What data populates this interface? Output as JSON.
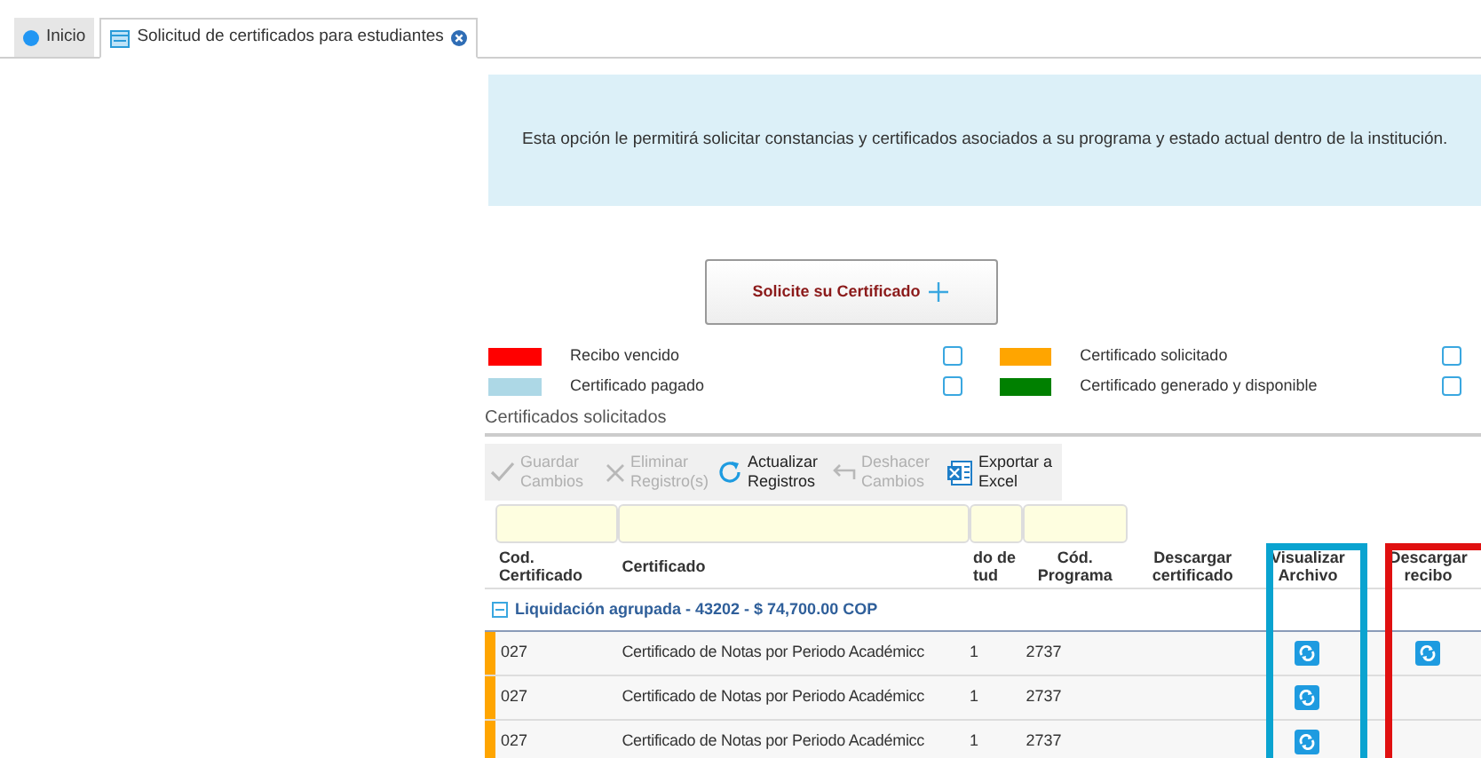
{
  "tabs": [
    {
      "label": "Inicio",
      "selected": false,
      "closable": false
    },
    {
      "label": "Solicitud de certificados para estudiantes",
      "selected": true,
      "closable": true
    }
  ],
  "info": "Esta opción le permitirá solicitar constancias y certificados asociados a su programa y estado actual dentro de la institución.",
  "request_button": {
    "label": "Solicite su Certificado"
  },
  "legend": [
    {
      "label": "Recibo vencido",
      "color": "#ff0000",
      "checked": false
    },
    {
      "label": "Certificado solicitado",
      "color": "#ffa500",
      "checked": false
    },
    {
      "label": "Certificado pagado",
      "color": "#add8e6",
      "checked": false
    },
    {
      "label": "Certificado generado y disponible",
      "color": "#008000",
      "checked": false
    }
  ],
  "section_title": "Certificados solicitados",
  "toolbar": [
    {
      "label": "Guardar Cambios",
      "kind": "check",
      "disabled": true
    },
    {
      "label": "Eliminar Registro(s)",
      "kind": "delete",
      "disabled": true
    },
    {
      "label": "Actualizar Registros",
      "kind": "refresh",
      "disabled": false
    },
    {
      "label": "Deshacer Cambios",
      "kind": "undo",
      "disabled": true
    },
    {
      "label": "Exportar a Excel",
      "kind": "excel",
      "disabled": false
    }
  ],
  "columns": [
    {
      "label": "Cod. Certificado",
      "filter": true
    },
    {
      "label": "Certificado",
      "filter": true
    },
    {
      "label": "do de tud",
      "filter": true
    },
    {
      "label": "Cód. Programa",
      "filter": true
    },
    {
      "label": "Descargar certificado",
      "filter": false
    },
    {
      "label": "Visualizar Archivo",
      "filter": false,
      "color": "#0aa3d0"
    },
    {
      "label": "Descargar recibo",
      "filter": false,
      "color": "#e01010"
    }
  ],
  "group": {
    "label": "Liquidación agrupada - 43202 - $ 74,700.00 COP",
    "expanded": true
  },
  "rows": [
    {
      "color": "#ffa500",
      "code": "027",
      "certificate": "Certificado de Notas por Periodo Académicc",
      "column_3": "1",
      "program": "2737",
      "view_file": true,
      "receipt": true
    },
    {
      "color": "#ffa500",
      "code": "027",
      "certificate": "Certificado de Notas por Periodo Académicc",
      "column_3": "1",
      "program": "2737",
      "view_file": true,
      "receipt": false
    },
    {
      "color": "#ffa500",
      "code": "027",
      "certificate": "Certificado de Notas por Periodo Académicc",
      "column_3": "1",
      "program": "2737",
      "view_file": true,
      "receipt": false
    }
  ]
}
